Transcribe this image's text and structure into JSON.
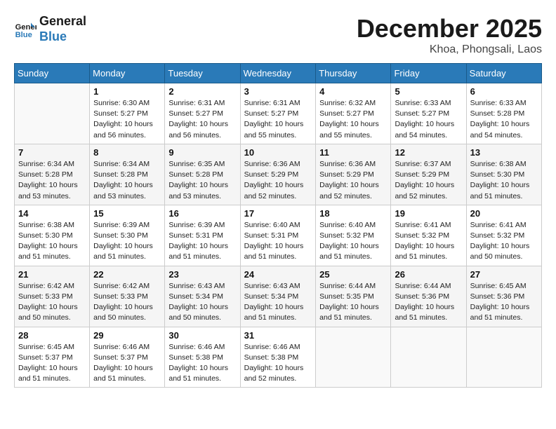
{
  "header": {
    "logo_line1": "General",
    "logo_line2": "Blue",
    "month_title": "December 2025",
    "location": "Khoa, Phongsali, Laos"
  },
  "weekdays": [
    "Sunday",
    "Monday",
    "Tuesday",
    "Wednesday",
    "Thursday",
    "Friday",
    "Saturday"
  ],
  "weeks": [
    [
      {
        "day": "",
        "info": ""
      },
      {
        "day": "1",
        "info": "Sunrise: 6:30 AM\nSunset: 5:27 PM\nDaylight: 10 hours\nand 56 minutes."
      },
      {
        "day": "2",
        "info": "Sunrise: 6:31 AM\nSunset: 5:27 PM\nDaylight: 10 hours\nand 56 minutes."
      },
      {
        "day": "3",
        "info": "Sunrise: 6:31 AM\nSunset: 5:27 PM\nDaylight: 10 hours\nand 55 minutes."
      },
      {
        "day": "4",
        "info": "Sunrise: 6:32 AM\nSunset: 5:27 PM\nDaylight: 10 hours\nand 55 minutes."
      },
      {
        "day": "5",
        "info": "Sunrise: 6:33 AM\nSunset: 5:27 PM\nDaylight: 10 hours\nand 54 minutes."
      },
      {
        "day": "6",
        "info": "Sunrise: 6:33 AM\nSunset: 5:28 PM\nDaylight: 10 hours\nand 54 minutes."
      }
    ],
    [
      {
        "day": "7",
        "info": "Sunrise: 6:34 AM\nSunset: 5:28 PM\nDaylight: 10 hours\nand 53 minutes."
      },
      {
        "day": "8",
        "info": "Sunrise: 6:34 AM\nSunset: 5:28 PM\nDaylight: 10 hours\nand 53 minutes."
      },
      {
        "day": "9",
        "info": "Sunrise: 6:35 AM\nSunset: 5:28 PM\nDaylight: 10 hours\nand 53 minutes."
      },
      {
        "day": "10",
        "info": "Sunrise: 6:36 AM\nSunset: 5:29 PM\nDaylight: 10 hours\nand 52 minutes."
      },
      {
        "day": "11",
        "info": "Sunrise: 6:36 AM\nSunset: 5:29 PM\nDaylight: 10 hours\nand 52 minutes."
      },
      {
        "day": "12",
        "info": "Sunrise: 6:37 AM\nSunset: 5:29 PM\nDaylight: 10 hours\nand 52 minutes."
      },
      {
        "day": "13",
        "info": "Sunrise: 6:38 AM\nSunset: 5:30 PM\nDaylight: 10 hours\nand 51 minutes."
      }
    ],
    [
      {
        "day": "14",
        "info": "Sunrise: 6:38 AM\nSunset: 5:30 PM\nDaylight: 10 hours\nand 51 minutes."
      },
      {
        "day": "15",
        "info": "Sunrise: 6:39 AM\nSunset: 5:30 PM\nDaylight: 10 hours\nand 51 minutes."
      },
      {
        "day": "16",
        "info": "Sunrise: 6:39 AM\nSunset: 5:31 PM\nDaylight: 10 hours\nand 51 minutes."
      },
      {
        "day": "17",
        "info": "Sunrise: 6:40 AM\nSunset: 5:31 PM\nDaylight: 10 hours\nand 51 minutes."
      },
      {
        "day": "18",
        "info": "Sunrise: 6:40 AM\nSunset: 5:32 PM\nDaylight: 10 hours\nand 51 minutes."
      },
      {
        "day": "19",
        "info": "Sunrise: 6:41 AM\nSunset: 5:32 PM\nDaylight: 10 hours\nand 51 minutes."
      },
      {
        "day": "20",
        "info": "Sunrise: 6:41 AM\nSunset: 5:32 PM\nDaylight: 10 hours\nand 50 minutes."
      }
    ],
    [
      {
        "day": "21",
        "info": "Sunrise: 6:42 AM\nSunset: 5:33 PM\nDaylight: 10 hours\nand 50 minutes."
      },
      {
        "day": "22",
        "info": "Sunrise: 6:42 AM\nSunset: 5:33 PM\nDaylight: 10 hours\nand 50 minutes."
      },
      {
        "day": "23",
        "info": "Sunrise: 6:43 AM\nSunset: 5:34 PM\nDaylight: 10 hours\nand 50 minutes."
      },
      {
        "day": "24",
        "info": "Sunrise: 6:43 AM\nSunset: 5:34 PM\nDaylight: 10 hours\nand 51 minutes."
      },
      {
        "day": "25",
        "info": "Sunrise: 6:44 AM\nSunset: 5:35 PM\nDaylight: 10 hours\nand 51 minutes."
      },
      {
        "day": "26",
        "info": "Sunrise: 6:44 AM\nSunset: 5:36 PM\nDaylight: 10 hours\nand 51 minutes."
      },
      {
        "day": "27",
        "info": "Sunrise: 6:45 AM\nSunset: 5:36 PM\nDaylight: 10 hours\nand 51 minutes."
      }
    ],
    [
      {
        "day": "28",
        "info": "Sunrise: 6:45 AM\nSunset: 5:37 PM\nDaylight: 10 hours\nand 51 minutes."
      },
      {
        "day": "29",
        "info": "Sunrise: 6:46 AM\nSunset: 5:37 PM\nDaylight: 10 hours\nand 51 minutes."
      },
      {
        "day": "30",
        "info": "Sunrise: 6:46 AM\nSunset: 5:38 PM\nDaylight: 10 hours\nand 51 minutes."
      },
      {
        "day": "31",
        "info": "Sunrise: 6:46 AM\nSunset: 5:38 PM\nDaylight: 10 hours\nand 52 minutes."
      },
      {
        "day": "",
        "info": ""
      },
      {
        "day": "",
        "info": ""
      },
      {
        "day": "",
        "info": ""
      }
    ]
  ]
}
